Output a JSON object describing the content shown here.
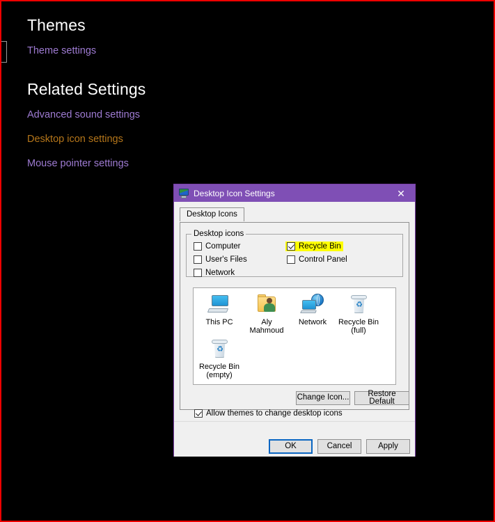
{
  "settings_page": {
    "headings": {
      "themes": "Themes",
      "related_settings": "Related Settings"
    },
    "links": [
      {
        "label": "Theme settings",
        "color": "#9e7bd2",
        "state": "unvisited"
      },
      {
        "label": "Advanced sound settings",
        "color": "#9e7bd2",
        "state": "unvisited"
      },
      {
        "label": "Desktop icon settings",
        "color": "#b5761a",
        "state": "visited"
      },
      {
        "label": "Mouse pointer settings",
        "color": "#9e7bd2",
        "state": "unvisited"
      }
    ],
    "background_color": "#000000",
    "frame_color": "#ee0000"
  },
  "dialog": {
    "title": "Desktop Icon Settings",
    "titlebar_color": "#7f4fb5",
    "icon_name": "display-monitor-icon",
    "close_glyph": "✕",
    "tabs": [
      {
        "label": "Desktop Icons",
        "selected": true
      }
    ],
    "group_desktop_icons": {
      "label": "Desktop icons",
      "checkboxes": [
        {
          "label": "Computer",
          "checked": false,
          "highlighted": false
        },
        {
          "label": "User's Files",
          "checked": false,
          "highlighted": false
        },
        {
          "label": "Network",
          "checked": false,
          "highlighted": false
        },
        {
          "label": "Recycle Bin",
          "checked": true,
          "highlighted": true
        },
        {
          "label": "Control Panel",
          "checked": false,
          "highlighted": false
        }
      ],
      "highlight_color": "#ffff00"
    },
    "preview_icons": [
      {
        "caption": "This PC",
        "icon": "computer-monitor-icon"
      },
      {
        "caption": "Aly Mahmoud",
        "icon": "user-folder-icon"
      },
      {
        "caption": "Network",
        "icon": "network-globe-icon"
      },
      {
        "caption": "Recycle Bin\n(full)",
        "icon": "recycle-bin-full-icon",
        "line1": "Recycle Bin",
        "line2": "(full)"
      },
      {
        "caption": "Recycle Bin\n(empty)",
        "icon": "recycle-bin-empty-icon",
        "line1": "Recycle Bin",
        "line2": "(empty)"
      }
    ],
    "icon_buttons": {
      "change_icon": "Change Icon...",
      "restore_default": "Restore Default"
    },
    "allow_themes_checkbox": {
      "label": "Allow themes to change desktop icons",
      "checked": true
    },
    "action_buttons": {
      "ok": "OK",
      "cancel": "Cancel",
      "apply": "Apply",
      "focused": "ok",
      "focus_color": "#0a66c2"
    }
  }
}
